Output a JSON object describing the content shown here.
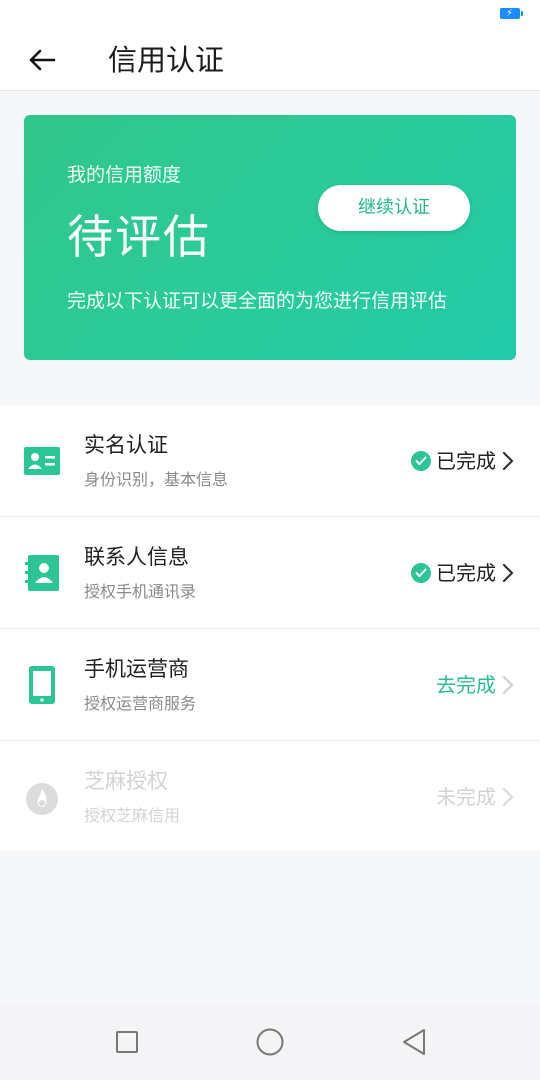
{
  "header": {
    "title": "信用认证"
  },
  "card": {
    "label": "我的信用额度",
    "status": "待评估",
    "description": "完成以下认证可以更全面的为您进行信用评估",
    "continue_label": "继续认证"
  },
  "items": [
    {
      "title": "实名认证",
      "subtitle": "身份识别，基本信息",
      "status": "已完成",
      "icon": "id-card-icon"
    },
    {
      "title": "联系人信息",
      "subtitle": "授权手机通讯录",
      "status": "已完成",
      "icon": "contacts-book-icon"
    },
    {
      "title": "手机运营商",
      "subtitle": "授权运营商服务",
      "status": "去完成",
      "icon": "mobile-phone-icon"
    },
    {
      "title": "芝麻授权",
      "subtitle": "授权芝麻信用",
      "status": "未完成",
      "icon": "sesame-icon"
    }
  ],
  "colors": {
    "accent": "#2cc596",
    "card_start": "#31c68c",
    "card_end": "#22caa9"
  }
}
